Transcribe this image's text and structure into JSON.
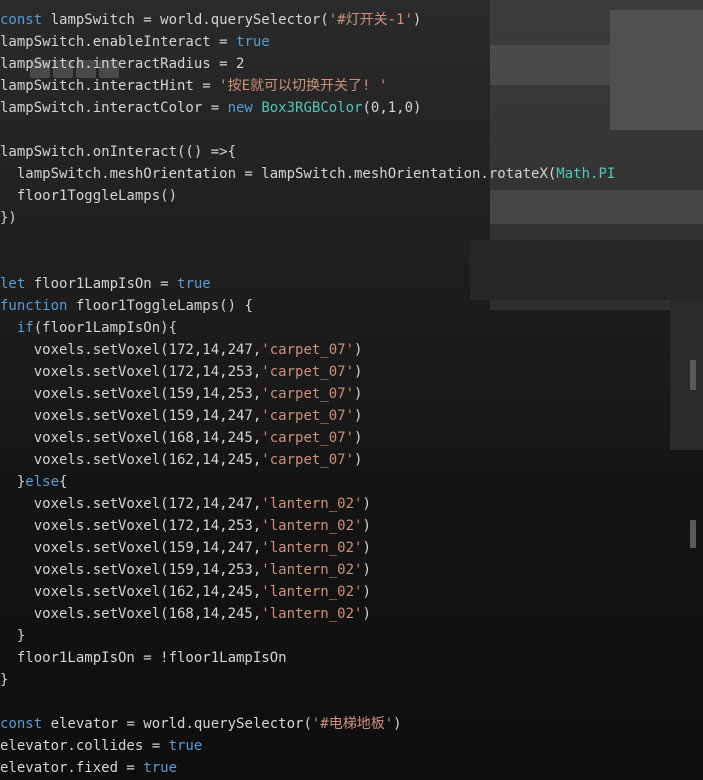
{
  "colors": {
    "keyword": "#569cd6",
    "string": "#ce9178",
    "type": "#4ec9b0",
    "text": "#d4d4d4"
  },
  "code": [
    [
      {
        "t": "k",
        "v": "const"
      },
      {
        "t": "p",
        "v": " lampSwitch = world.querySelector("
      },
      {
        "t": "s",
        "v": "'#灯开关-1'"
      },
      {
        "t": "p",
        "v": ")"
      }
    ],
    [
      {
        "t": "p",
        "v": "lampSwitch.enableInteract = "
      },
      {
        "t": "k",
        "v": "true"
      }
    ],
    [
      {
        "t": "p",
        "v": "lampSwitch.interactRadius = 2"
      }
    ],
    [
      {
        "t": "p",
        "v": "lampSwitch.interactHint = "
      },
      {
        "t": "s",
        "v": "'按E就可以切换开关了! '"
      }
    ],
    [
      {
        "t": "p",
        "v": "lampSwitch.interactColor = "
      },
      {
        "t": "k",
        "v": "new"
      },
      {
        "t": "p",
        "v": " "
      },
      {
        "t": "t",
        "v": "Box3RGBColor"
      },
      {
        "t": "p",
        "v": "(0,1,0)"
      }
    ],
    [],
    [
      {
        "t": "p",
        "v": "lampSwitch.onInteract(() =>{"
      }
    ],
    [
      {
        "t": "p",
        "v": "  lampSwitch.meshOrientation = lampSwitch.meshOrientation.rotateX("
      },
      {
        "t": "t",
        "v": "Math.PI"
      }
    ],
    [
      {
        "t": "p",
        "v": "  floor1ToggleLamps()"
      }
    ],
    [
      {
        "t": "p",
        "v": "})"
      }
    ],
    [],
    [],
    [
      {
        "t": "k",
        "v": "let"
      },
      {
        "t": "p",
        "v": " floor1LampIsOn = "
      },
      {
        "t": "k",
        "v": "true"
      }
    ],
    [
      {
        "t": "k",
        "v": "function"
      },
      {
        "t": "p",
        "v": " floor1ToggleLamps() {"
      }
    ],
    [
      {
        "t": "p",
        "v": "  "
      },
      {
        "t": "k",
        "v": "if"
      },
      {
        "t": "p",
        "v": "(floor1LampIsOn){"
      }
    ],
    [
      {
        "t": "p",
        "v": "    voxels.setVoxel(172,14,247,"
      },
      {
        "t": "s",
        "v": "'carpet_07'"
      },
      {
        "t": "p",
        "v": ")"
      }
    ],
    [
      {
        "t": "p",
        "v": "    voxels.setVoxel(172,14,253,"
      },
      {
        "t": "s",
        "v": "'carpet_07'"
      },
      {
        "t": "p",
        "v": ")"
      }
    ],
    [
      {
        "t": "p",
        "v": "    voxels.setVoxel(159,14,253,"
      },
      {
        "t": "s",
        "v": "'carpet_07'"
      },
      {
        "t": "p",
        "v": ")"
      }
    ],
    [
      {
        "t": "p",
        "v": "    voxels.setVoxel(159,14,247,"
      },
      {
        "t": "s",
        "v": "'carpet_07'"
      },
      {
        "t": "p",
        "v": ")"
      }
    ],
    [
      {
        "t": "p",
        "v": "    voxels.setVoxel(168,14,245,"
      },
      {
        "t": "s",
        "v": "'carpet_07'"
      },
      {
        "t": "p",
        "v": ")"
      }
    ],
    [
      {
        "t": "p",
        "v": "    voxels.setVoxel(162,14,245,"
      },
      {
        "t": "s",
        "v": "'carpet_07'"
      },
      {
        "t": "p",
        "v": ")"
      }
    ],
    [
      {
        "t": "p",
        "v": "  }"
      },
      {
        "t": "k",
        "v": "else"
      },
      {
        "t": "p",
        "v": "{"
      }
    ],
    [
      {
        "t": "p",
        "v": "    voxels.setVoxel(172,14,247,"
      },
      {
        "t": "s",
        "v": "'lantern_02'"
      },
      {
        "t": "p",
        "v": ")"
      }
    ],
    [
      {
        "t": "p",
        "v": "    voxels.setVoxel(172,14,253,"
      },
      {
        "t": "s",
        "v": "'lantern_02'"
      },
      {
        "t": "p",
        "v": ")"
      }
    ],
    [
      {
        "t": "p",
        "v": "    voxels.setVoxel(159,14,247,"
      },
      {
        "t": "s",
        "v": "'lantern_02'"
      },
      {
        "t": "p",
        "v": ")"
      }
    ],
    [
      {
        "t": "p",
        "v": "    voxels.setVoxel(159,14,253,"
      },
      {
        "t": "s",
        "v": "'lantern_02'"
      },
      {
        "t": "p",
        "v": ")"
      }
    ],
    [
      {
        "t": "p",
        "v": "    voxels.setVoxel(162,14,245,"
      },
      {
        "t": "s",
        "v": "'lantern_02'"
      },
      {
        "t": "p",
        "v": ")"
      }
    ],
    [
      {
        "t": "p",
        "v": "    voxels.setVoxel(168,14,245,"
      },
      {
        "t": "s",
        "v": "'lantern_02'"
      },
      {
        "t": "p",
        "v": ")"
      }
    ],
    [
      {
        "t": "p",
        "v": "  }"
      }
    ],
    [
      {
        "t": "p",
        "v": "  floor1LampIsOn = !floor1LampIsOn"
      }
    ],
    [
      {
        "t": "p",
        "v": "}"
      }
    ],
    [],
    [
      {
        "t": "k",
        "v": "const"
      },
      {
        "t": "p",
        "v": " elevator = world.querySelector("
      },
      {
        "t": "s",
        "v": "'#电梯地板'"
      },
      {
        "t": "p",
        "v": ")"
      }
    ],
    [
      {
        "t": "p",
        "v": "elevator.collides = "
      },
      {
        "t": "k",
        "v": "true"
      }
    ],
    [
      {
        "t": "p",
        "v": "elevator.fixed = "
      },
      {
        "t": "k",
        "v": "true"
      }
    ]
  ]
}
